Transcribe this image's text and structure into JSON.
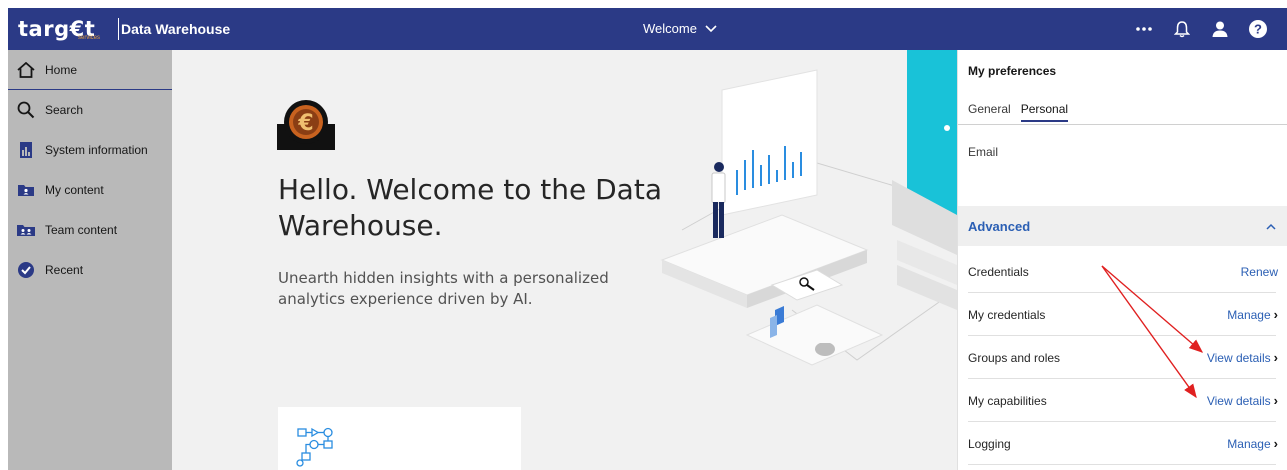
{
  "header": {
    "logo_text": "targ€t",
    "logo_subtext": "services",
    "app_title": "Data Warehouse",
    "welcome_menu": "Welcome",
    "icons": [
      "more-icon",
      "bell-icon",
      "user-icon",
      "help-icon"
    ]
  },
  "sidebar": {
    "items": [
      {
        "label": "Home",
        "icon": "home-icon"
      },
      {
        "label": "Search",
        "icon": "search-icon"
      },
      {
        "label": "System information",
        "icon": "system-info-icon"
      },
      {
        "label": "My content",
        "icon": "my-content-icon"
      },
      {
        "label": "Team content",
        "icon": "team-content-icon"
      },
      {
        "label": "Recent",
        "icon": "recent-icon"
      }
    ]
  },
  "main": {
    "title": "Hello. Welcome to the Data Warehouse.",
    "subtitle": "Unearth hidden insights with a personalized analytics experience driven by AI."
  },
  "panel": {
    "title": "My preferences",
    "tabs": [
      {
        "label": "General",
        "active": false
      },
      {
        "label": "Personal",
        "active": true
      }
    ],
    "email_label": "Email",
    "advanced": {
      "title": "Advanced",
      "rows": [
        {
          "label": "Credentials",
          "action": "Renew",
          "chevron": false
        },
        {
          "label": "My credentials",
          "action": "Manage",
          "chevron": true
        },
        {
          "label": "Groups and roles",
          "action": "View details",
          "chevron": true
        },
        {
          "label": "My capabilities",
          "action": "View details",
          "chevron": true
        },
        {
          "label": "Logging",
          "action": "Manage",
          "chevron": true
        }
      ]
    }
  },
  "colors": {
    "header_bg": "#2b3a86",
    "sidebar_bg": "#b9b9b9",
    "main_bg": "#f1f1f1",
    "link": "#2b5fb4",
    "annotation_arrow": "#e02020",
    "illustration_teal": "#19c2d8"
  }
}
